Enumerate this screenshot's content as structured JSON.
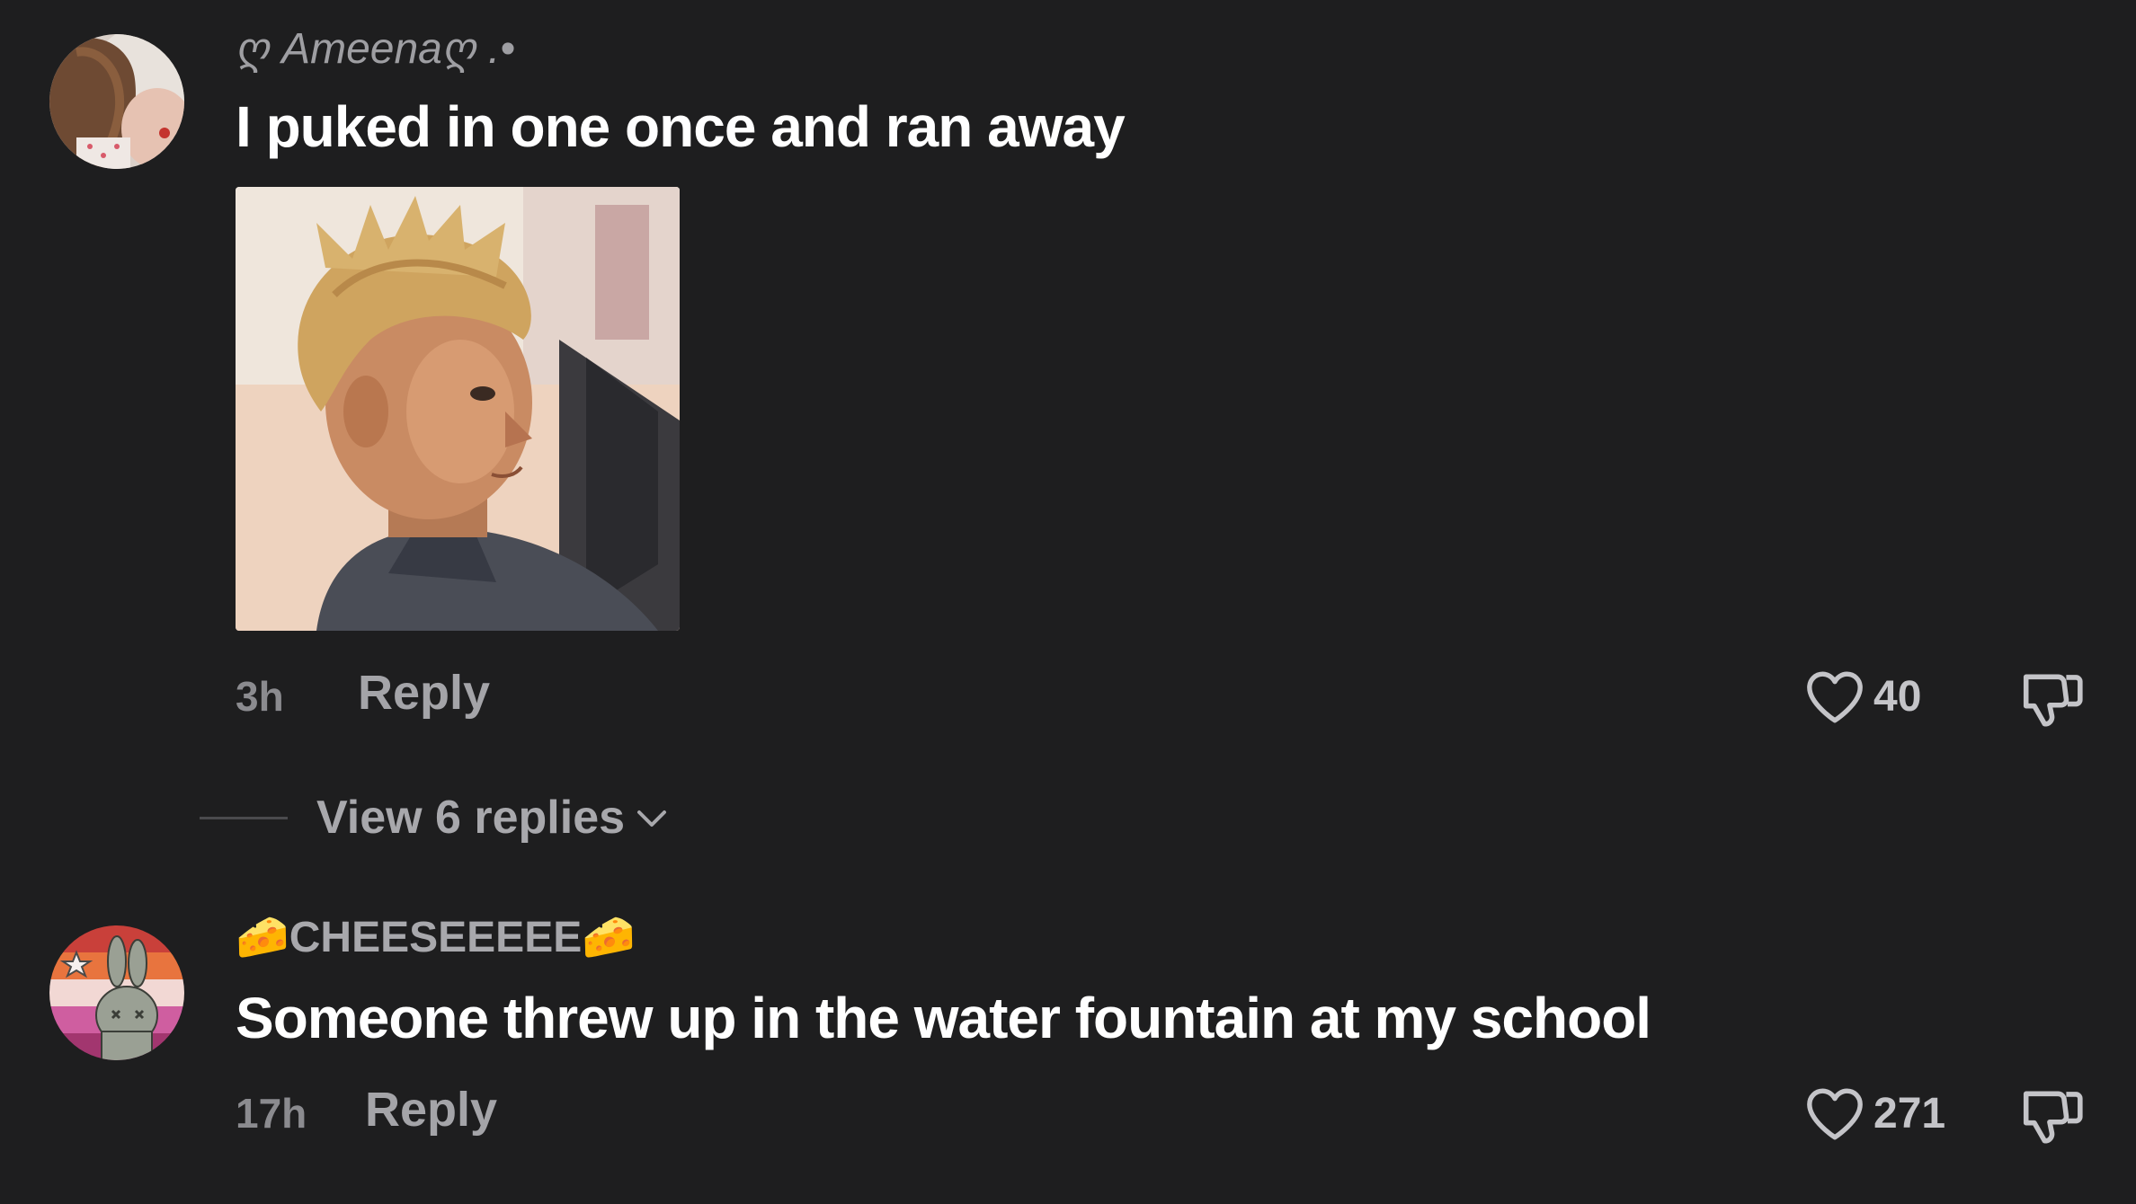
{
  "comments": [
    {
      "username": "ღ Ameenaღ .•",
      "text": "I puked in one once and ran away",
      "has_gif": true,
      "time": "3h",
      "reply_label": "Reply",
      "likes": "40"
    },
    {
      "username": "🧀CHEESEEEEE🧀",
      "text": "Someone threw up in the water fountain at my school",
      "has_gif": false,
      "time": "17h",
      "reply_label": "Reply",
      "likes": "271"
    }
  ],
  "view_replies": {
    "label": "View 6 replies"
  },
  "icons": {
    "like": "heart-outline-icon",
    "dislike": "thumbs-down-icon",
    "expand": "chevron-down-icon"
  },
  "colors": {
    "background": "#1e1e1f",
    "primary_text": "#ffffff",
    "secondary_text": "#a4a4a8"
  }
}
